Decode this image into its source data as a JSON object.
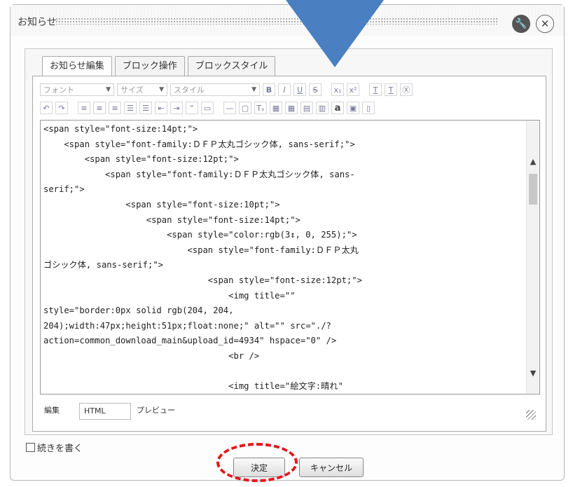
{
  "dialog": {
    "title": "お知らせ",
    "tabs": [
      "お知らせ編集",
      "ブロック操作",
      "ブロックスタイル"
    ]
  },
  "toolbar": {
    "font_select": "フォント",
    "size_select": "サイズ",
    "style_select": "スタイル",
    "row1_buttons": [
      "B",
      "I",
      "U",
      "S",
      "x₁",
      "x²",
      "T",
      "T",
      "Ⓧ"
    ],
    "row2_buttons": [
      "↶",
      "↷",
      "≡",
      "≡",
      "≡",
      "☰",
      "☰",
      "⇤",
      "⇥",
      "“",
      "▭",
      "—",
      "▢",
      "Tₓ",
      "▦",
      "▦",
      "▤",
      "▥",
      "a",
      "▣",
      "▯"
    ]
  },
  "editor": {
    "html_lines": [
      "<span style=\"font-size:14pt;\">",
      "    <span style=\"font-family:ＤＦＰ太丸ゴシック体, sans-serif;\">",
      "        <span style=\"font-size:12pt;\">",
      "            <span style=\"font-family:ＤＦＰ太丸ゴシック体, sans-",
      "serif;\">",
      "                <span style=\"font-size:10pt;\">",
      "                    <span style=\"font-size:14pt;\">",
      "                        <span style=\"color:rgb(3↕, 0, 255);\">",
      "                            <span style=\"font-family:ＤＦＰ太丸",
      "ゴシック体, sans-serif;\">",
      "                                <span style=\"font-size:12pt;\">",
      "                                    <img title=\"\"",
      "style=\"border:0px solid rgb(204, 204,",
      "204);width:47px;height:51px;float:none;\" alt=\"\" src=\"./?",
      "action=common_download_main&upload_id=4934\" hspace=\"0\" />",
      "                                    <br />",
      "",
      "                                    <img title=\"絵文字:晴れ\""
    ]
  },
  "modes": [
    "編集",
    "HTML",
    "プレビュー"
  ],
  "continue_label": "続きを書く",
  "buttons": {
    "ok": "決定",
    "cancel": "キャンセル"
  },
  "colors": {
    "annotation_ring": "#e5151c",
    "annotation_arrow": "#4a7fc1"
  }
}
